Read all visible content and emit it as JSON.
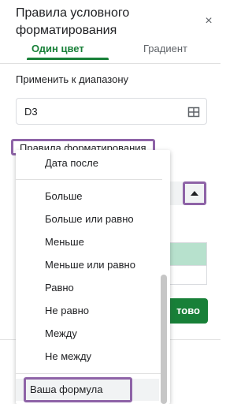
{
  "panel": {
    "title": "Правила условного форматирования",
    "close_glyph": "×"
  },
  "tabs": [
    {
      "label": "Один цвет",
      "active": true
    },
    {
      "label": "Градиент",
      "active": false
    }
  ],
  "range": {
    "label": "Применить к диапазону",
    "value": "D3",
    "icon": "grid-icon"
  },
  "rules": {
    "label": "Правила форматирования"
  },
  "done_button": {
    "label_partial": "тово"
  },
  "dropdown": {
    "items": [
      {
        "label": "Дата после"
      },
      {
        "label": "Больше"
      },
      {
        "label": "Больше или равно"
      },
      {
        "label": "Меньше"
      },
      {
        "label": "Меньше или равно"
      },
      {
        "label": "Равно"
      },
      {
        "label": "Не равно"
      },
      {
        "label": "Между"
      },
      {
        "label": "Не между"
      },
      {
        "label": "Ваша формула"
      }
    ]
  },
  "colors": {
    "accent_green": "#188038",
    "highlight_purple": "#8e63a7",
    "preview_green": "#b7e1cd"
  }
}
